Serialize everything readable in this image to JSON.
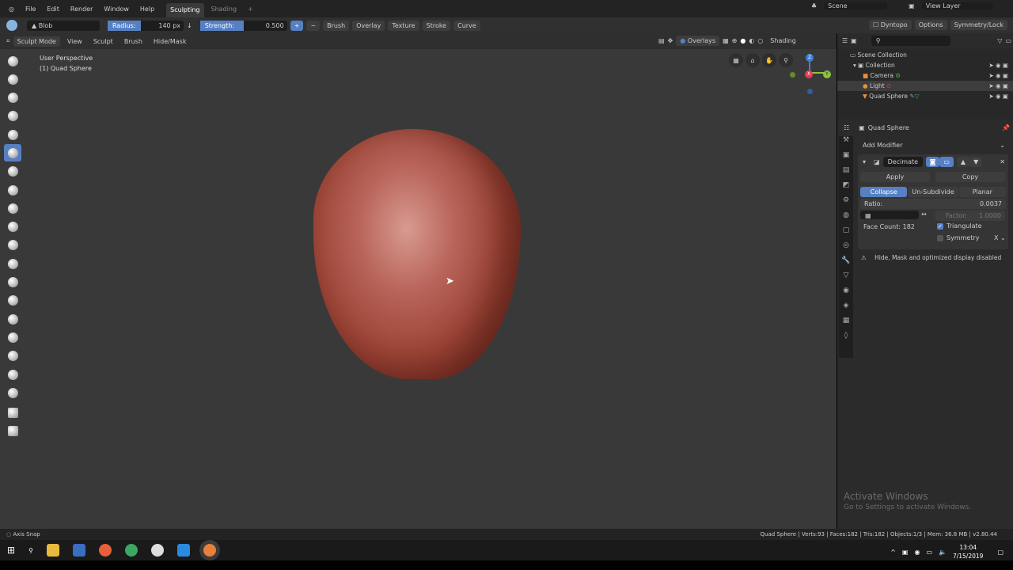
{
  "menu": {
    "items": [
      "File",
      "Edit",
      "Render",
      "Window",
      "Help"
    ],
    "tabs": [
      "Sculpting",
      "Shading"
    ],
    "add_tab": "+",
    "scene": "Scene",
    "view_layer": "View Layer"
  },
  "tool_header": {
    "brush_name": "Blob",
    "radius_label": "Radius:",
    "radius_value": "140 px",
    "strength_label": "Strength:",
    "strength_value": "0.500",
    "plus": "+",
    "minus": "−",
    "menus": [
      "Brush",
      "Overlay",
      "Texture",
      "Stroke",
      "Curve"
    ],
    "dyntopo": "Dyntopo",
    "options": "Options",
    "symmetry": "Symmetry/Lock"
  },
  "viewport_header": {
    "mode": "Sculpt Mode",
    "menus": [
      "View",
      "Sculpt",
      "Brush",
      "Hide/Mask"
    ],
    "overlays": "Overlays",
    "shading": "Shading"
  },
  "viewport": {
    "perspective": "User Perspective",
    "object": "(1) Quad Sphere",
    "gizmo": {
      "z": "Z",
      "x": "X",
      "y": "Y"
    }
  },
  "outliner": {
    "root": "Scene Collection",
    "collection": "Collection",
    "items": [
      "Camera",
      "Light",
      "Quad Sphere"
    ]
  },
  "properties": {
    "object": "Quad Sphere",
    "add_modifier": "Add Modifier",
    "modifier_name": "Decimate",
    "apply": "Apply",
    "copy": "Copy",
    "modes": [
      "Collapse",
      "Un-Subdivide",
      "Planar"
    ],
    "ratio_label": "Ratio:",
    "ratio_value": "0.0037",
    "factor_label": "Factor:",
    "factor_value": "1.0000",
    "face_count": "Face Count: 182",
    "triangulate": "Triangulate",
    "symmetry": "Symmetry",
    "symmetry_axis": "X",
    "warning": "Hide, Mask and optimized display disabled"
  },
  "watermark": {
    "title": "Activate Windows",
    "subtitle": "Go to Settings to activate Windows."
  },
  "status": {
    "left": "Axis Snap",
    "right": "Quad Sphere | Verts:93 | Faces:182 | Tris:182 | Objects:1/3 | Mem: 36.8 MB | v2.80.44"
  },
  "taskbar": {
    "time": "13:04",
    "date": "7/15/2019"
  },
  "colors": {
    "accent": "#5680c2",
    "blob": "#a8483a"
  }
}
